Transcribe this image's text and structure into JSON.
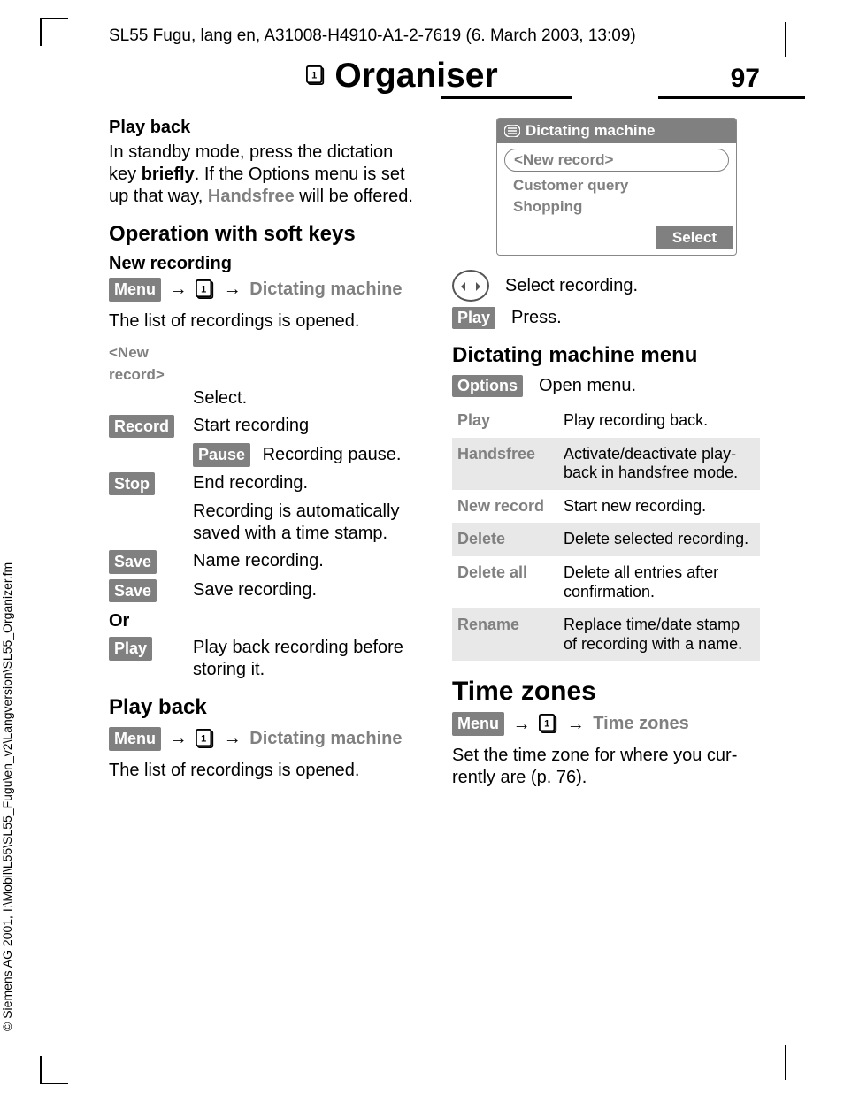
{
  "doc_header": "SL55 Fugu, lang en, A31008-H4910-A1-2-7619 (6. March 2003, 13:09)",
  "side_credit": "© Siemens AG 2001, I:\\Mobil\\L55\\SL55_Fugu\\en_v2\\Langversion\\SL55_Organizer.fm",
  "page_title": "Organiser",
  "page_num": "97",
  "left": {
    "playback_h": "Play back",
    "playback_p1": "In standby mode, press the dictation key ",
    "playback_bold": "briefly",
    "playback_p2": ". If the Options menu is set up that way, ",
    "playback_grey": "Handsfree",
    "playback_p3": " will be offered.",
    "opkeys_h": "Operation with soft keys",
    "newrec_h": "New recording",
    "menu_btn": "§Menu§",
    "dict_grey": "Dictating machine",
    "list_opened": "The list of recordings is opened.",
    "newrec_label": "<New record>",
    "newrec_select": "Select.",
    "k_record": "§Record§",
    "v_record": "Start recording",
    "k_pause": "§Pause§",
    "v_pause": "Recording pause.",
    "k_stop": "§Stop§",
    "v_stop": "End recording.",
    "v_stop2": "Recording is automatical­ly saved with a time stamp.",
    "k_save1": "§Save§",
    "v_save1": "Name recording.",
    "k_save2": "§Save§",
    "v_save2": "Save recording.",
    "or": "Or",
    "k_play": "§Play§",
    "v_play": "Play back recording be­fore storing it.",
    "playback2_h": "Play back"
  },
  "right": {
    "screen_title": "Dictating machine",
    "row1": "<New record>",
    "row2": "Customer query",
    "row3": "Shopping",
    "select_btn": "Select",
    "nav_text": "Select recording.",
    "play_btn": "§Play§",
    "play_text": "Press.",
    "menu_h": "Dictating machine menu",
    "options_btn": "§Options§",
    "options_text": "Open menu.",
    "table": [
      {
        "k": "Play",
        "v": "Play recording back."
      },
      {
        "k": "Handsfree",
        "v": "Activate/deactivate play­back in handsfree mode."
      },
      {
        "k": "New record",
        "v": "Start new recording."
      },
      {
        "k": "Delete",
        "v": "Delete selected recording."
      },
      {
        "k": "Delete all",
        "v": "Delete all entries after confirmation."
      },
      {
        "k": "Rename",
        "v": "Replace time/date stamp of recording with a name."
      }
    ],
    "tz_h": "Time zones",
    "tz_grey": "Time zones",
    "tz_p": "Set the time zone for where you cur­rently are (p. 76)."
  }
}
